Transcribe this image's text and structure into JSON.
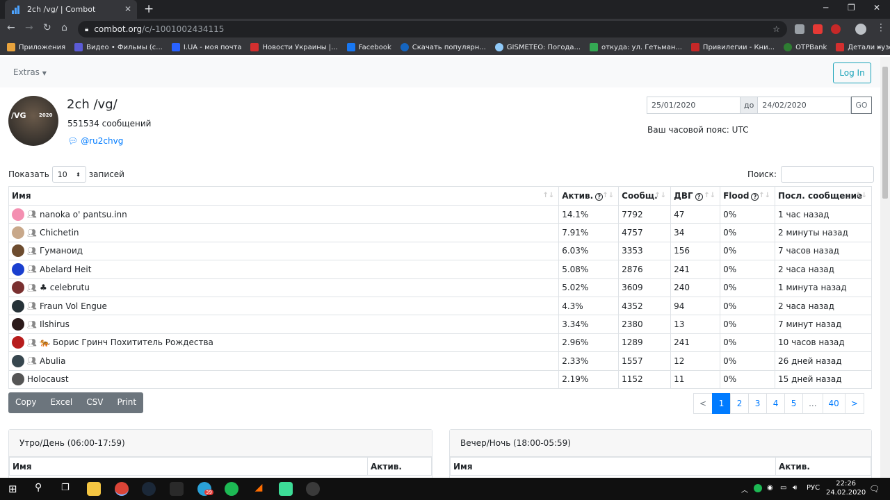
{
  "browser": {
    "tab_title": "2ch /vg/ | Combot",
    "url_host": "combot.org",
    "url_path": "/c/-1001002434115",
    "bookmarks": [
      {
        "label": "Приложения",
        "color": "#e8a33d"
      },
      {
        "label": "Видео • Фильмы (с...",
        "color": "#5b5bd6"
      },
      {
        "label": "I.UA - моя почта",
        "color": "#2962ff"
      },
      {
        "label": "Новости Украины |...",
        "color": "#d32f2f"
      },
      {
        "label": "Facebook",
        "color": "#1877f2"
      },
      {
        "label": "Скачать популярн...",
        "color": "#1565c0"
      },
      {
        "label": "GISMETEO: Погода...",
        "color": "#90caf9"
      },
      {
        "label": "откуда: ул. Гетьман...",
        "color": "#34a853"
      },
      {
        "label": "Привилегии - Кни...",
        "color": "#c62828"
      },
      {
        "label": "OTPBank",
        "color": "#2e7d32"
      },
      {
        "label": "Детали кузова для...",
        "color": "#d32f2f"
      }
    ]
  },
  "nav": {
    "extras": "Extras",
    "login": "Log In"
  },
  "chat": {
    "title": "2ch /vg/",
    "messages": "551534 сообщений",
    "username": "@ru2chvg",
    "avatar_text": "/VG",
    "avatar_year": "2020"
  },
  "dates": {
    "from": "25/01/2020",
    "sep": "до",
    "to": "24/02/2020",
    "go": "GO",
    "timezone": "Ваш часовой пояс: UTC"
  },
  "table_controls": {
    "show_prefix": "Показать",
    "show_value": "10",
    "show_suffix": "записей",
    "search_label": "Поиск:"
  },
  "table": {
    "headers": [
      "Имя",
      "Актив.",
      "Сообщ.",
      "ДВГ",
      "Flood",
      "Посл. сообщение"
    ],
    "rows": [
      {
        "name": "nanoka o' pantsu.inn",
        "activity": "14.1%",
        "messages": "7792",
        "dvg": "47",
        "flood": "0%",
        "last": "1 час назад",
        "color": "#f48fb1"
      },
      {
        "name": "Chichetin",
        "activity": "7.91%",
        "messages": "4757",
        "dvg": "34",
        "flood": "0%",
        "last": "2 минуты назад",
        "color": "#c8a88a"
      },
      {
        "name": "Гуманоид",
        "activity": "6.03%",
        "messages": "3353",
        "dvg": "156",
        "flood": "0%",
        "last": "7 часов назад",
        "color": "#6d4c2f"
      },
      {
        "name": "Abelard Heit",
        "activity": "5.08%",
        "messages": "2876",
        "dvg": "241",
        "flood": "0%",
        "last": "2 часа назад",
        "color": "#1a3fcf"
      },
      {
        "name": "celebrutu",
        "activity": "5.02%",
        "messages": "3609",
        "dvg": "240",
        "flood": "0%",
        "last": "1 минута назад",
        "color": "#7a3030",
        "emoji": "♣"
      },
      {
        "name": "Fraun Vol Engue",
        "activity": "4.3%",
        "messages": "4352",
        "dvg": "94",
        "flood": "0%",
        "last": "2 часа назад",
        "color": "#263238"
      },
      {
        "name": "Ilshirus",
        "activity": "3.34%",
        "messages": "2380",
        "dvg": "13",
        "flood": "0%",
        "last": "7 минут назад",
        "color": "#2b1a1a"
      },
      {
        "name": "Борис Гринч Похититель Рождества",
        "activity": "2.96%",
        "messages": "1289",
        "dvg": "241",
        "flood": "0%",
        "last": "10 часов назад",
        "color": "#b71c1c",
        "emoji": "🐅"
      },
      {
        "name": "Abulia",
        "activity": "2.33%",
        "messages": "1557",
        "dvg": "12",
        "flood": "0%",
        "last": "26 дней назад",
        "color": "#37474f"
      },
      {
        "name": "Holocaust",
        "activity": "2.19%",
        "messages": "1152",
        "dvg": "11",
        "flood": "0%",
        "last": "15 дней назад",
        "color": "#555555"
      }
    ]
  },
  "export_buttons": [
    "Copy",
    "Excel",
    "CSV",
    "Print"
  ],
  "pagination": [
    "<",
    "1",
    "2",
    "3",
    "4",
    "5",
    "...",
    "40",
    ">"
  ],
  "panels": [
    {
      "title": "Утро/День (06:00-17:59)",
      "col1": "Имя",
      "col2": "Актив."
    },
    {
      "title": "Вечер/Ночь (18:00-05:59)",
      "col1": "Имя",
      "col2": "Актив."
    }
  ],
  "taskbar": {
    "lang": "РУС",
    "time": "22:26",
    "date": "24.02.2020",
    "badge": "39"
  }
}
